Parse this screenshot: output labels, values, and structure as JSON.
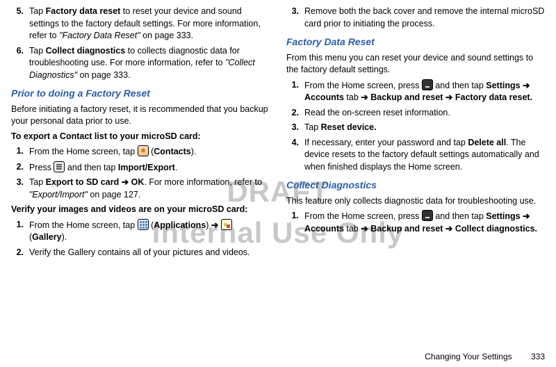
{
  "watermark": {
    "line1": "DRAFT",
    "line2": "Internal Use Only"
  },
  "left": {
    "step5": {
      "num": "5.",
      "text_a": "Tap ",
      "bold_b": "Factory data reset",
      "text_c": " to reset your device and sound settings to the factory default settings. For more information, refer to ",
      "italic_d": "\"Factory Data Reset\"",
      "text_e": "  on page 333."
    },
    "step6": {
      "num": "6.",
      "text_a": "Tap ",
      "bold_b": "Collect diagnostics",
      "text_c": " to collects diagnostic data for troubleshooting use. For more information, refer to ",
      "italic_d": "\"Collect Diagnostics\"",
      "text_e": "  on page 333."
    },
    "h_prior": "Prior to doing a Factory Reset",
    "prior_para": "Before initiating a factory reset, it is recommended that you backup your personal data prior to use.",
    "export_lead": "To export a Contact list to your microSD card:",
    "export": {
      "s1": {
        "num": "1.",
        "a": "From the Home screen, tap ",
        "paren_open": " (",
        "bold": "Contacts",
        "paren_close": ")."
      },
      "s2": {
        "num": "2.",
        "a": "Press ",
        "b": " and then tap ",
        "bold": "Import/Export",
        "end": "."
      },
      "s3": {
        "num": "3.",
        "a": "Tap ",
        "bold1": "Export to SD card",
        "arrow": " ➔ ",
        "bold2": "OK",
        "b": ". For more information, refer to ",
        "italic": "\"Export/Import\"",
        "c": "  on page 127."
      }
    },
    "verify_lead": "Verify your images and videos are on your microSD card:",
    "verify": {
      "s1": {
        "num": "1.",
        "a": "From the Home screen, tap ",
        "paren1_open": " (",
        "bold1": "Applications",
        "paren1_close": ") ",
        "arrow": "➔",
        "paren2_open": " (",
        "bold2": "Gallery",
        "paren2_close": ")."
      },
      "s2": {
        "num": "2.",
        "a": "Verify the Gallery contains all of your pictures and videos."
      }
    }
  },
  "right": {
    "step3": {
      "num": "3.",
      "text": "Remove both the back cover and remove the internal microSD card prior to initiating the process."
    },
    "h_fdr": "Factory Data Reset",
    "fdr_para": "From this menu you can reset your device and sound settings to the factory default settings.",
    "fdr": {
      "s1": {
        "num": "1.",
        "a": "From the Home screen, press ",
        "b": " and then tap ",
        "bold1": "Settings",
        "arr1": " ➔ ",
        "bold2": "Accounts",
        "tab": " tab ",
        "arr2": "➔ ",
        "bold3": "Backup and reset",
        "arr3": " ➔ ",
        "bold4": "Factory data reset."
      },
      "s2": {
        "num": "2.",
        "a": "Read the on-screen reset information."
      },
      "s3": {
        "num": "3.",
        "a": "Tap ",
        "bold": "Reset device."
      },
      "s4": {
        "num": "4.",
        "a": "If necessary, enter your password and tap ",
        "bold": "Delete all",
        "b": ". The device resets to the factory default settings automatically and when finished displays the Home screen."
      }
    },
    "h_cd": "Collect Diagnostics",
    "cd_para": "This feature only collects diagnostic data for troubleshooting use.",
    "cd": {
      "s1": {
        "num": "1.",
        "a": "From the Home screen, press ",
        "b": " and then tap ",
        "bold1": "Settings",
        "arr1": " ➔ ",
        "bold2": "Accounts",
        "tab": " tab ",
        "arr2": "➔ ",
        "bold3": "Backup and reset",
        "arr3": " ➔ ",
        "bold4": "Collect diagnostics."
      }
    }
  },
  "footer": {
    "section": "Changing Your Settings",
    "page": "333"
  }
}
